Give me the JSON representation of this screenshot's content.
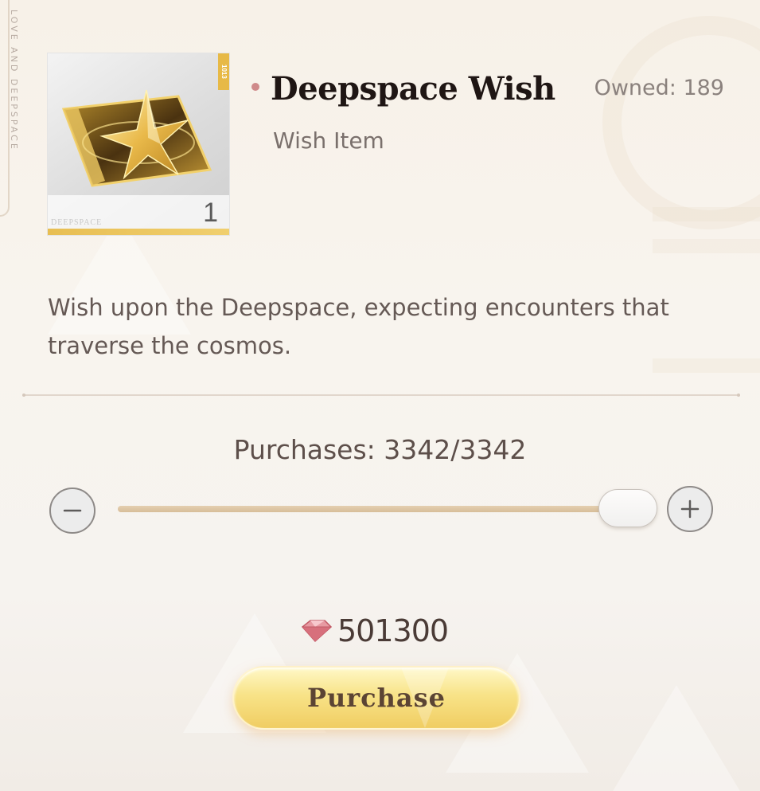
{
  "side_text": "LOVE AND DEEPSPACE",
  "item": {
    "name": "Deepspace Wish",
    "type": "Wish Item",
    "owned_label": "Owned: 189",
    "quantity": "1",
    "card_brand": "DEEPSPACE",
    "card_tag": "1013",
    "description": "Wish upon the Deepspace, expecting encounters that traverse the cosmos."
  },
  "purchase": {
    "label": "Purchases: 3342/3342",
    "current": 3342,
    "max": 3342,
    "slider_fraction": 1.0,
    "decrease_icon": "minus-icon",
    "increase_icon": "plus-icon"
  },
  "cost": {
    "currency_icon": "diamond-gem-icon",
    "value": "501300"
  },
  "button": {
    "label": "Purchase"
  },
  "colors": {
    "title": "#1f1614",
    "accent_gold": "#f0cd62",
    "dot": "#cf8a8a"
  }
}
